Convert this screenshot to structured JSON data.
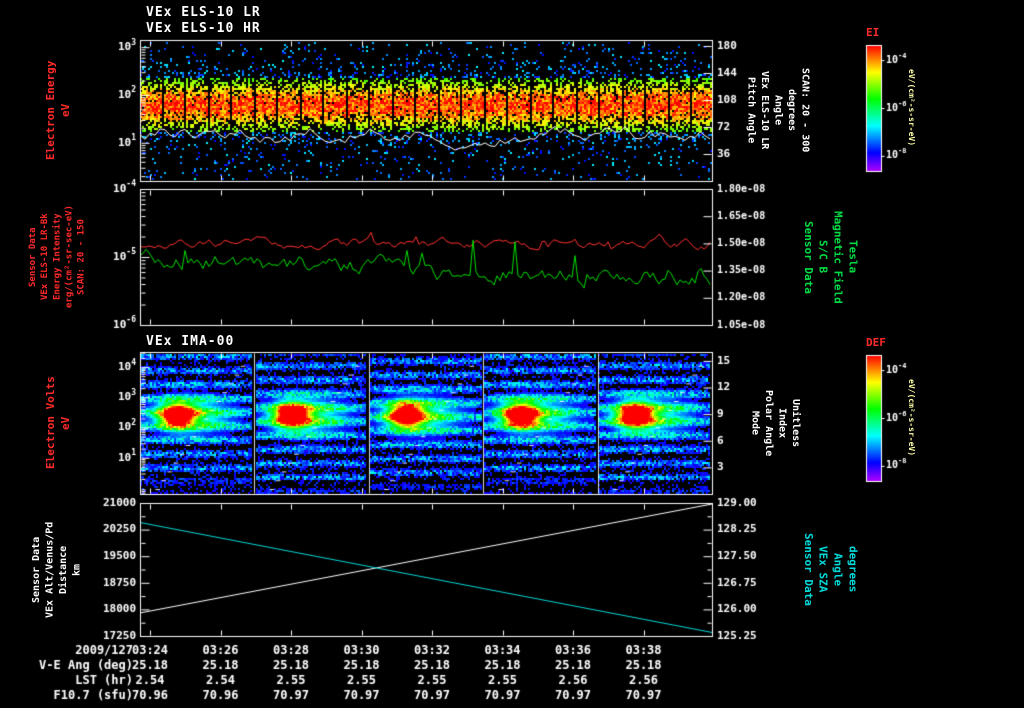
{
  "header": {
    "els_lr": "VEx ELS-10 LR",
    "els_hr": "VEx ELS-10 HR",
    "ima": "VEx IMA-00"
  },
  "side_labels": {
    "p1_left": {
      "lines": [
        "Electron Energy",
        "eV"
      ]
    },
    "p2_left": {
      "lines": [
        "Sensor Data",
        "VEx ELS-10 LR-Bk",
        "Energy Intensity",
        "erg/(cm²-sr-sec-eV)",
        "SCAN: 20 - 150"
      ]
    },
    "p3_left": {
      "lines": [
        "Electron Volts",
        "eV"
      ]
    },
    "p4_left": {
      "lines": [
        "Sensor Data",
        "VEx Alt/Venus/Pd",
        "Distance",
        "km"
      ]
    },
    "p1_right": {
      "lines": [
        "Pitch Angle",
        "VEx ELS-10 LR",
        "Angle",
        "degrees",
        "SCAN: 20 - 300"
      ]
    },
    "p2_right": {
      "lines": [
        "Sensor Data",
        "S/C B",
        "Magnetic Field",
        "Tesla"
      ]
    },
    "p3_right": {
      "lines": [
        "Mode",
        "Polar Angle",
        "Index",
        "Unitless"
      ]
    },
    "p4_right": {
      "lines": [
        "Sensor Data",
        "VEx SZA",
        "Angle",
        "degrees"
      ]
    }
  },
  "chart_data": [
    {
      "id": "els-energy-spectrogram",
      "type": "heatmap",
      "instrument": "VEx ELS-10 LR / VEx ELS-10 HR",
      "x_axis": {
        "date": "2009/127",
        "start": "03:24",
        "end": "03:39"
      },
      "y_axis": {
        "label": "Electron Energy eV",
        "scale": "log",
        "ticks": [
          "10^3",
          "10^2",
          "10^1"
        ],
        "range_exp": [
          0.2,
          3.15
        ]
      },
      "right_axis": {
        "label": "Pitch Angle VEx ELS-10 LR Angle degrees SCAN: 20 - 300",
        "ticks": [
          "180",
          "144",
          "108",
          "72",
          "36"
        ],
        "range": [
          0,
          188
        ]
      },
      "features": {
        "peak_band_exp": 1.8,
        "telemetry_segments": 25,
        "overlay": "white spacecraft-potential trace near 10^1.2 eV"
      },
      "colorbar": {
        "title": "EI",
        "ticks": [
          "10^-4",
          "10^-6",
          "10^-8"
        ],
        "units": "eV/(cm²-s-sr-eV)"
      }
    },
    {
      "id": "els-intensity-and-magnetic-field",
      "type": "line",
      "series": [
        {
          "name": "VEx ELS-10 LR-Bk Energy Intensity",
          "color": "#ff3030",
          "axis": "left",
          "units": "erg/(cm²-sr-sec-eV)",
          "level_exp": -4.8
        },
        {
          "name": "S/C B Magnetic Field",
          "color": "#00dd00",
          "axis": "right",
          "units": "Tesla",
          "start": 1.42e-08,
          "end": 1.29e-08,
          "spikes_to": 1.6e-08
        }
      ],
      "y_axis": {
        "scale": "log",
        "ticks": [
          "10^-4",
          "10^-5",
          "10^-6"
        ],
        "range_exp": [
          -6,
          -4
        ]
      },
      "right_axis": {
        "ticks": [
          "1.80e-08",
          "1.65e-08",
          "1.50e-08",
          "1.35e-08",
          "1.20e-08",
          "1.05e-08"
        ],
        "range": [
          1.05e-08,
          1.8e-08
        ]
      }
    },
    {
      "id": "ima-spectrogram",
      "type": "heatmap",
      "instrument": "VEx IMA-00",
      "y_axis": {
        "label": "Electron Volts eV",
        "scale": "log",
        "ticks": [
          "10^4",
          "10^3",
          "10^2",
          "10^1"
        ],
        "range_exp": [
          -0.2,
          4.5
        ]
      },
      "right_axis": {
        "label": "Mode Polar Angle Index Unitless",
        "ticks": [
          "15",
          "12",
          "9",
          "6",
          "3"
        ],
        "range": [
          0,
          16
        ]
      },
      "features": {
        "sweep_segments": 5,
        "hot_blob_frac_y": 0.44,
        "overlay": "white energy-sweep staircase lines"
      },
      "colorbar": {
        "title": "DEF",
        "ticks": [
          "10^-4",
          "10^-6",
          "10^-8"
        ],
        "units": "eV/(cm²-s-sr-eV)"
      }
    },
    {
      "id": "altitude-and-sza",
      "type": "line",
      "series": [
        {
          "name": "VEx Alt/Venus/Pd Distance",
          "color": "#ffffff",
          "axis": "left",
          "units": "km",
          "start": 17900,
          "end": 21050
        },
        {
          "name": "VEx SZA",
          "color": "#00d8d8",
          "axis": "right",
          "units": "degrees",
          "start": 128.45,
          "end": 125.35
        }
      ],
      "y_axis": {
        "ticks": [
          "21000",
          "20250",
          "19500",
          "18750",
          "18000",
          "17250"
        ],
        "range": [
          17250,
          21000
        ]
      },
      "right_axis": {
        "ticks": [
          "129.00",
          "128.25",
          "127.50",
          "126.75",
          "126.00",
          "125.25"
        ],
        "range": [
          125.25,
          129.0
        ]
      }
    }
  ],
  "time_axis": {
    "date": "2009/127",
    "ticks": [
      "03:24",
      "03:26",
      "03:28",
      "03:30",
      "03:32",
      "03:34",
      "03:36",
      "03:38"
    ],
    "rows": [
      {
        "label": "V-E Ang (deg)",
        "values": [
          "25.18",
          "25.18",
          "25.18",
          "25.18",
          "25.18",
          "25.18",
          "25.18",
          "25.18"
        ]
      },
      {
        "label": "LST (hr)",
        "values": [
          "2.54",
          "2.54",
          "2.55",
          "2.55",
          "2.55",
          "2.55",
          "2.56",
          "2.56"
        ]
      },
      {
        "label": "F10.7 (sfu)",
        "values": [
          "70.96",
          "70.96",
          "70.97",
          "70.97",
          "70.97",
          "70.97",
          "70.97",
          "70.97"
        ]
      }
    ]
  }
}
